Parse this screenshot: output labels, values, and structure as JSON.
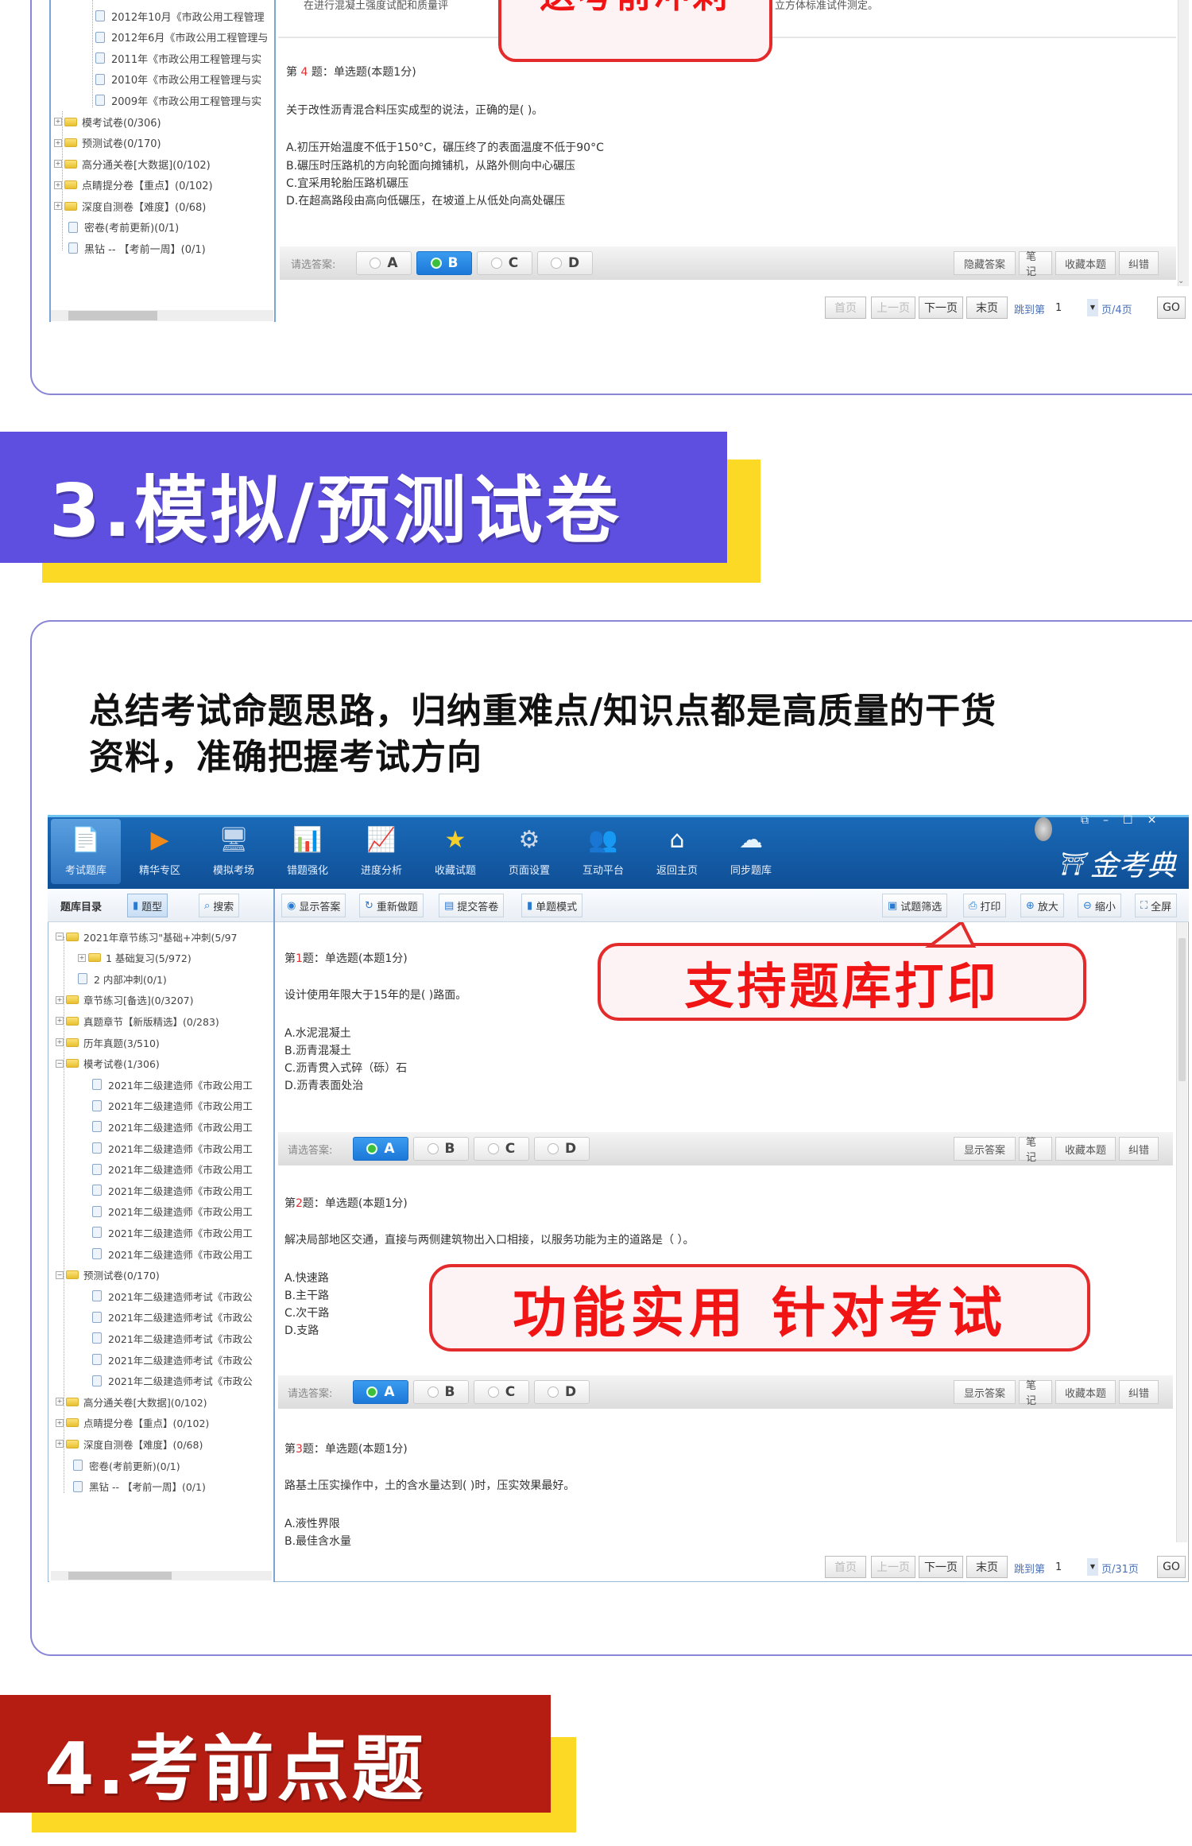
{
  "panel1": {
    "tree": {
      "items": [
        {
          "label": "2012年10月《市政公用工程管理",
          "type": "doc"
        },
        {
          "label": "2012年6月《市政公用工程管理与",
          "type": "doc"
        },
        {
          "label": "2011年《市政公用工程管理与实",
          "type": "doc"
        },
        {
          "label": "2010年《市政公用工程管理与实",
          "type": "doc"
        },
        {
          "label": "2009年《市政公用工程管理与实",
          "type": "doc"
        },
        {
          "label": "模考试卷(0/306)",
          "type": "folder"
        },
        {
          "label": "预测试卷(0/170)",
          "type": "folder"
        },
        {
          "label": "高分通关卷[大数据](0/102)",
          "type": "folder"
        },
        {
          "label": "点睛提分卷【重点】(0/102)",
          "type": "folder"
        },
        {
          "label": "深度自测卷【难度】(0/68)",
          "type": "folder"
        },
        {
          "label": "密卷(考前更新)(0/1)",
          "type": "doc"
        },
        {
          "label": "黑钻 -- 【考前一周】(0/1)",
          "type": "doc"
        }
      ]
    },
    "prev_text_left": "在进行混凝土强度试配和质量评",
    "prev_text_right": "立方体标准试件测定。",
    "callout": "送考前冲刺",
    "question": {
      "prefix": "第",
      "number": "4",
      "suffix": "题：单选题(本题1分)",
      "stem": "关于改性沥青混合料压实成型的说法，正确的是( )。",
      "options": [
        "A.初压开始温度不低于150°C，碾压终了的表面温度不低于90°C",
        "B.碾压时压路机的方向轮面向摊铺机，从路外侧向中心碾压",
        "C.宜采用轮胎压路机碾压",
        "D.在超高路段由高向低碾压，在坡道上从低处向高处碾压"
      ]
    },
    "answer_bar": {
      "label": "请选答案:",
      "choices": [
        "A",
        "B",
        "C",
        "D"
      ],
      "selected": "B",
      "actions": [
        "隐藏答案",
        "笔记",
        "收藏本题",
        "纠错"
      ]
    },
    "pagination": {
      "first": "首页",
      "prev": "上一页",
      "next": "下一页",
      "last": "末页",
      "jump_label": "跳到第",
      "page_value": "1",
      "total": "页/4页",
      "go": "GO"
    }
  },
  "banner3": {
    "text": "3.模拟/预测试卷",
    "color": "#5f4fe0",
    "accent": "#fbd924"
  },
  "panel2": {
    "headline_line1": "总结考试命题思路，归纳重难点/知识点都是高质量的干货",
    "headline_line2": "资料，准确把握考试方向",
    "app": {
      "toolbar": [
        {
          "label": "考试题库",
          "icon": "exam-bank-icon",
          "glyph": "📄",
          "active": true
        },
        {
          "label": "精华专区",
          "icon": "play-circle-icon",
          "glyph": "▶"
        },
        {
          "label": "模拟考场",
          "icon": "monitor-icon",
          "glyph": "🖥"
        },
        {
          "label": "错题强化",
          "icon": "bag-chart-icon",
          "glyph": "📊"
        },
        {
          "label": "进度分析",
          "icon": "board-chart-icon",
          "glyph": "📈"
        },
        {
          "label": "收藏试题",
          "icon": "star-icon",
          "glyph": "★"
        },
        {
          "label": "页面设置",
          "icon": "gear-icon",
          "glyph": "⚙"
        },
        {
          "label": "互动平台",
          "icon": "users-icon",
          "glyph": "👥"
        },
        {
          "label": "返回主页",
          "icon": "home-icon",
          "glyph": "⌂"
        },
        {
          "label": "同步题库",
          "icon": "cloud-sync-icon",
          "glyph": "☁"
        }
      ],
      "brand": "金考典",
      "window_controls": [
        "restore",
        "minimize",
        "maximize",
        "close"
      ],
      "left_tabs": [
        "题库目录",
        "题型",
        "搜索"
      ],
      "sub_toolbar_left": [
        {
          "label": "显示答案",
          "icon": "eye-icon",
          "glyph": "◉"
        },
        {
          "label": "重新做题",
          "icon": "refresh-icon",
          "glyph": "↻"
        },
        {
          "label": "提交答卷",
          "icon": "submit-icon",
          "glyph": "▤"
        },
        {
          "label": "单题模式",
          "icon": "single-page-icon",
          "glyph": "▮"
        }
      ],
      "sub_toolbar_right": [
        {
          "label": "试题筛选",
          "icon": "filter-icon",
          "glyph": "▣"
        },
        {
          "label": "打印",
          "icon": "printer-icon",
          "glyph": "⎙"
        },
        {
          "label": "放大",
          "icon": "zoom-in-icon",
          "glyph": "⊕"
        },
        {
          "label": "缩小",
          "icon": "zoom-out-icon",
          "glyph": "⊖"
        },
        {
          "label": "全屏",
          "icon": "fullscreen-icon",
          "glyph": "⛶"
        }
      ],
      "tree": [
        {
          "label": "2021年章节练习\"基础+冲刺(5/97",
          "type": "folder",
          "level": 0,
          "exp": "−"
        },
        {
          "label": "1 基础复习(5/972)",
          "type": "folder",
          "level": 1,
          "exp": "+"
        },
        {
          "label": "2 内部冲刺(0/1)",
          "type": "doc",
          "level": 1
        },
        {
          "label": "章节练习[备选](0/3207)",
          "type": "folder",
          "level": 0,
          "exp": "+"
        },
        {
          "label": "真题章节【新版精选】(0/283)",
          "type": "folder",
          "level": 0,
          "exp": "+"
        },
        {
          "label": "历年真题(3/510)",
          "type": "folder",
          "level": 0,
          "exp": "+"
        },
        {
          "label": "模考试卷(1/306)",
          "type": "folder",
          "level": 0,
          "exp": "−"
        },
        {
          "label": "2021年二级建造师《市政公用工",
          "type": "doc",
          "level": 1
        },
        {
          "label": "2021年二级建造师《市政公用工",
          "type": "doc",
          "level": 1
        },
        {
          "label": "2021年二级建造师《市政公用工",
          "type": "doc",
          "level": 1
        },
        {
          "label": "2021年二级建造师《市政公用工",
          "type": "doc",
          "level": 1
        },
        {
          "label": "2021年二级建造师《市政公用工",
          "type": "doc",
          "level": 1
        },
        {
          "label": "2021年二级建造师《市政公用工",
          "type": "doc",
          "level": 1
        },
        {
          "label": "2021年二级建造师《市政公用工",
          "type": "doc",
          "level": 1
        },
        {
          "label": "2021年二级建造师《市政公用工",
          "type": "doc",
          "level": 1
        },
        {
          "label": "2021年二级建造师《市政公用工",
          "type": "doc",
          "level": 1
        },
        {
          "label": "预测试卷(0/170)",
          "type": "folder",
          "level": 0,
          "exp": "−"
        },
        {
          "label": "2021年二级建造师考试《市政公",
          "type": "doc",
          "level": 1
        },
        {
          "label": "2021年二级建造师考试《市政公",
          "type": "doc",
          "level": 1
        },
        {
          "label": "2021年二级建造师考试《市政公",
          "type": "doc",
          "level": 1
        },
        {
          "label": "2021年二级建造师考试《市政公",
          "type": "doc",
          "level": 1
        },
        {
          "label": "2021年二级建造师考试《市政公",
          "type": "doc",
          "level": 1
        },
        {
          "label": "高分通关卷[大数据](0/102)",
          "type": "folder",
          "level": 0,
          "exp": "+"
        },
        {
          "label": "点睛提分卷【重点】(0/102)",
          "type": "folder",
          "level": 0,
          "exp": "+"
        },
        {
          "label": "深度自测卷【难度】(0/68)",
          "type": "folder",
          "level": 0,
          "exp": "+"
        },
        {
          "label": "密卷(考前更新)(0/1)",
          "type": "doc",
          "level": 0
        },
        {
          "label": "黑钻 -- 【考前一周】(0/1)",
          "type": "doc",
          "level": 0
        }
      ],
      "questions": [
        {
          "prefix": "第",
          "number": "1",
          "suffix": "题：单选题(本题1分)",
          "stem": "设计使用年限大于15年的是( )路面。",
          "options": [
            "A.水泥混凝土",
            "B.沥青混凝土",
            "C.沥青贯入式碎（砾）石",
            "D.沥青表面处治"
          ],
          "selected": "A"
        },
        {
          "prefix": "第",
          "number": "2",
          "suffix": "题：单选题(本题1分)",
          "stem": "解决局部地区交通，直接与两侧建筑物出入口相接，以服务功能为主的道路是（ ）。",
          "options": [
            "A.快速路",
            "B.主干路",
            "C.次干路",
            "D.支路"
          ],
          "selected": "A"
        },
        {
          "prefix": "第",
          "number": "3",
          "suffix": "题：单选题(本题1分)",
          "stem": "路基土压实操作中，土的含水量达到( )时，压实效果最好。",
          "options": [
            "A.液性界限",
            "B.最佳含水量"
          ]
        }
      ],
      "answer_label": "请选答案:",
      "choices": [
        "A",
        "B",
        "C",
        "D"
      ],
      "actions": [
        "显示答案",
        "笔记",
        "收藏本题",
        "纠错"
      ],
      "callout_print": "支持题库打印",
      "callout_func": "功能实用 针对考试",
      "pagination": {
        "first": "首页",
        "prev": "上一页",
        "next": "下一页",
        "last": "末页",
        "jump_label": "跳到第",
        "page_value": "1",
        "total": "页/31页",
        "go": "GO"
      }
    }
  },
  "banner4": {
    "text": "4.考前点题",
    "color": "#b51d12",
    "accent": "#fbd924"
  }
}
